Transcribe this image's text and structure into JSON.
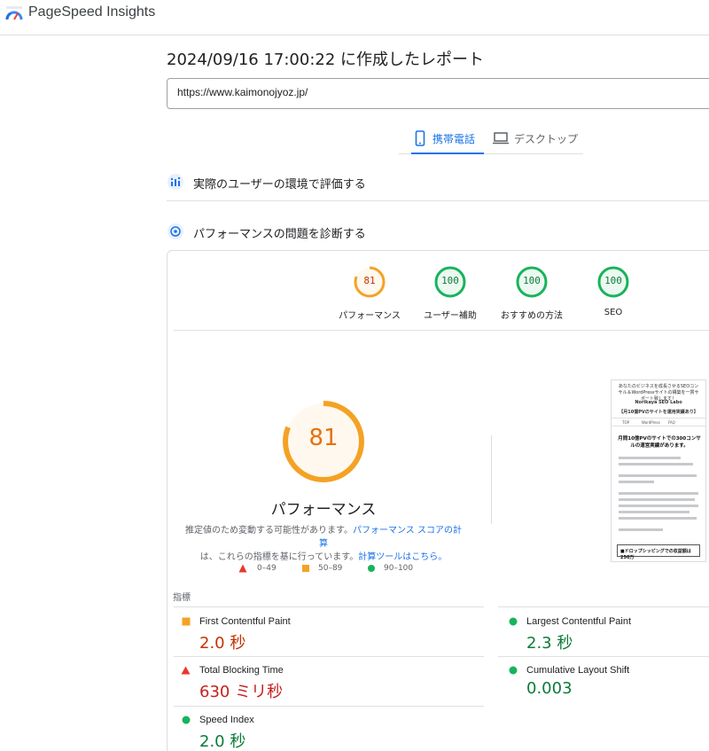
{
  "app": {
    "name": "PageSpeed Insights"
  },
  "report": {
    "title": "2024/09/16 17:00:22 に作成したレポート",
    "url": "https://www.kaimonojyoz.jp/"
  },
  "tabs": [
    {
      "label": "携帯電話",
      "icon": "mobile-phone-icon",
      "active": true
    },
    {
      "label": "デスクトップ",
      "icon": "laptop-icon",
      "active": false
    }
  ],
  "sections": {
    "field_data_label": "実際のユーザーの環境で評価する",
    "lab_data_label": "パフォーマンスの問題を診断する"
  },
  "scores": [
    {
      "value": "81",
      "label": "パフォーマンス",
      "status": "average"
    },
    {
      "value": "100",
      "label": "ユーザー補助",
      "status": "pass"
    },
    {
      "value": "100",
      "label": "おすすめの方法",
      "status": "pass"
    },
    {
      "value": "100",
      "label": "SEO",
      "status": "pass"
    }
  ],
  "performance": {
    "score": "81",
    "score_fraction": 0.81,
    "label": "パフォーマンス",
    "note_prefix": "推定値のため変動する可能性があります。",
    "note_link1": "パフォーマンス スコアの計算",
    "note_middle": "は、これらの指標を基に行っています。",
    "note_link2": "計算ツールはこちら。"
  },
  "legend": [
    {
      "range": "0–49",
      "shape": "triangle",
      "color": "#e8382b"
    },
    {
      "range": "50–89",
      "shape": "square",
      "color": "#f4a225"
    },
    {
      "range": "90–100",
      "shape": "circle",
      "color": "#18b35b"
    }
  ],
  "screenshot": {
    "top_text": "あなたのビジネスを成長させるSEOコンサル＆WordPressサイトの構築を一貫サポート致します！",
    "site_name": "Norikaya SEO Labo",
    "tagline": "【月10億PVのサイトを運用実績あり】",
    "nav": [
      "TOP",
      "WordPress",
      "FAQ"
    ],
    "headline": "月間10億PVのサイトでの300コンサルの運営実績があります。",
    "box_text": "■ドロップシッピングでの収益額は250万"
  },
  "metrics": {
    "heading": "指標",
    "items": [
      {
        "name": "First Contentful Paint",
        "value": "2.0 秒",
        "status": "average"
      },
      {
        "name": "Largest Contentful Paint",
        "value": "2.3 秒",
        "status": "pass"
      },
      {
        "name": "Total Blocking Time",
        "value": "630 ミリ秒",
        "status": "fail"
      },
      {
        "name": "Cumulative Layout Shift",
        "value": "0.003",
        "status": "pass"
      },
      {
        "name": "Speed Index",
        "value": "2.0 秒",
        "status": "pass"
      }
    ]
  },
  "colors": {
    "pass": "#0c7b39",
    "average": "#c33300",
    "fail": "#c5221f",
    "accent": "#1a73e8",
    "gauge_orange": "#f4a225",
    "gauge_green": "#18b35b"
  }
}
